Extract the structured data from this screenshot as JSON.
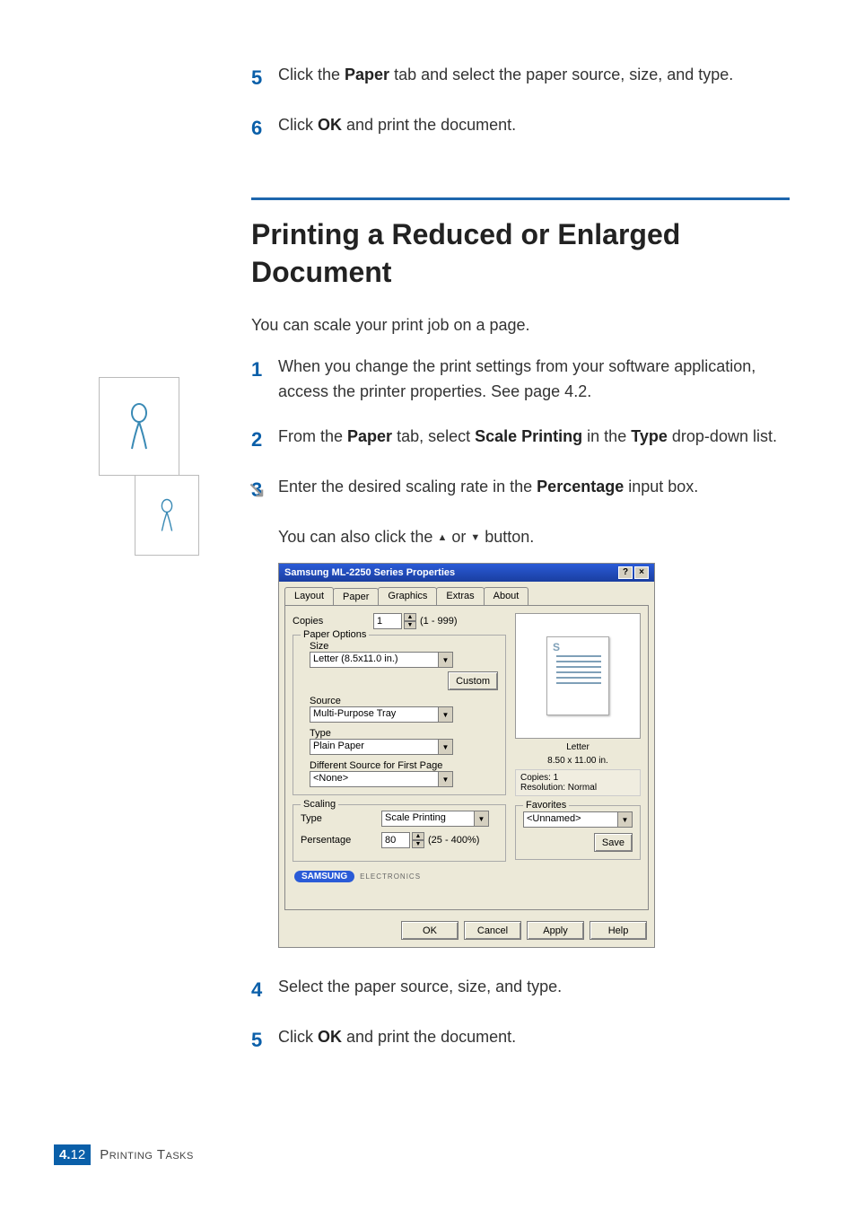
{
  "top_steps": {
    "s5": {
      "num": "5",
      "pre": "Click the ",
      "b1": "Paper",
      "post": " tab and select the paper source, size, and type."
    },
    "s6": {
      "num": "6",
      "pre": "Click ",
      "b1": "OK",
      "post": " and print the document."
    }
  },
  "section_heading": "Printing a Reduced or Enlarged Document",
  "intro": "You can scale your print job on a page.",
  "steps": {
    "s1": {
      "num": "1",
      "text": "When you change the print settings from your software application, access the printer properties. See page 4.2."
    },
    "s2": {
      "num": "2",
      "pre1": "From the ",
      "b1": "Paper",
      "mid1": " tab, select ",
      "b2": "Scale Printing",
      "mid2": " in the ",
      "b3": "Type",
      "post": " drop-down list."
    },
    "s3": {
      "num": "3",
      "pre1": "Enter the desired scaling rate in the ",
      "b1": "Percentage",
      "post": " input box."
    },
    "s3_sub": {
      "pre": "You can also click the ",
      "mid": " or ",
      "post": " button."
    },
    "s4": {
      "num": "4",
      "text": "Select the paper source, size, and type."
    },
    "s5": {
      "num": "5",
      "pre": "Click ",
      "b1": "OK",
      "post": " and print the document."
    }
  },
  "dialog": {
    "title": "Samsung ML-2250 Series Properties",
    "help_btn": "?",
    "close_btn": "×",
    "tabs": [
      "Layout",
      "Paper",
      "Graphics",
      "Extras",
      "About"
    ],
    "active_tab_index": 1,
    "copies": {
      "label": "Copies",
      "value": "1",
      "range": "(1 - 999)"
    },
    "paper_options": {
      "legend": "Paper Options",
      "size": {
        "label": "Size",
        "value": "Letter (8.5x11.0 in.)",
        "custom_btn": "Custom"
      },
      "source": {
        "label": "Source",
        "value": "Multi-Purpose Tray"
      },
      "type": {
        "label": "Type",
        "value": "Plain Paper"
      },
      "diff_source": {
        "label": "Different Source for First Page",
        "value": "<None>"
      }
    },
    "scaling": {
      "legend": "Scaling",
      "type": {
        "label": "Type",
        "value": "Scale Printing"
      },
      "persentage": {
        "label": "Persentage",
        "value": "80",
        "range": "(25 - 400%)"
      }
    },
    "preview": {
      "s_mark": "S",
      "paper_caption_line1": "Letter",
      "paper_caption_line2": "8.50 x 11.00 in.",
      "info_line1": "Copies: 1",
      "info_line2": "Resolution: Normal"
    },
    "favorites": {
      "legend": "Favorites",
      "value": "<Unnamed>",
      "save_btn": "Save"
    },
    "brand": {
      "name": "SAMSUNG",
      "sub": "ELECTRONICS"
    },
    "buttons": {
      "ok": "OK",
      "cancel": "Cancel",
      "apply": "Apply",
      "help": "Help"
    }
  },
  "footer": {
    "chapter": "4.",
    "page": "12",
    "label": "Printing Tasks"
  }
}
